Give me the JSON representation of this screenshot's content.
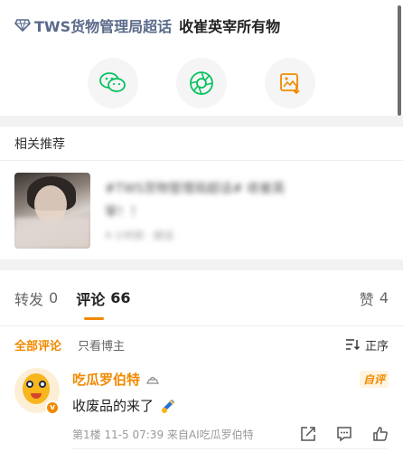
{
  "topic": {
    "name": "TWS货物管理局超话",
    "text": "收崔英宰所有物",
    "icon": "diamond-icon"
  },
  "share": [
    {
      "name": "wechat-icon",
      "color": "#07c160"
    },
    {
      "name": "moments-icon",
      "color": "#07c160"
    },
    {
      "name": "save-image-icon",
      "color": "#f08a00"
    }
  ],
  "related": {
    "title": "相关推荐",
    "card": {
      "line1": "#TWS货物管理局超话# 收崔英",
      "line2": "宰！！",
      "line3": "4 小时前 · 超话"
    }
  },
  "tabs": {
    "repost_label": "转发",
    "repost_count": "0",
    "comment_label": "评论",
    "comment_count": "66",
    "like_label": "赞",
    "like_count": "4"
  },
  "filters": {
    "all": "全部评论",
    "owner_only": "只看博主",
    "sort": "正序"
  },
  "comment": {
    "name": "吃瓜罗伯特",
    "tag": "自评",
    "text": "收废品的来了",
    "meta": "第1楼 11-5 07:39 来自AI吃瓜罗伯特"
  },
  "colors": {
    "accent": "#f08a00",
    "topic": "#5a6a8a"
  }
}
